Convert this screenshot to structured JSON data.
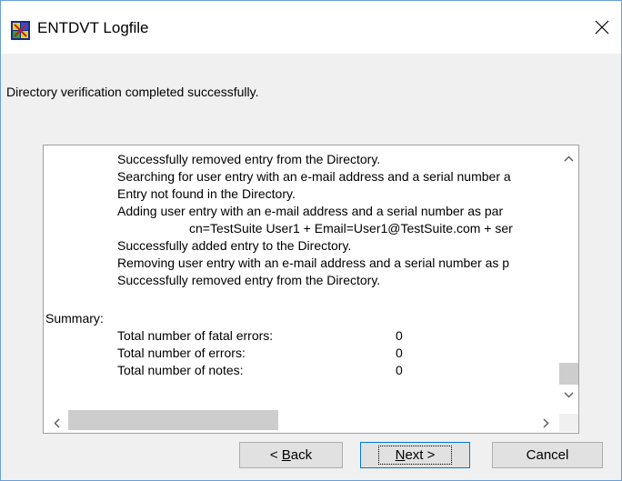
{
  "window": {
    "title": "ENTDVT Logfile"
  },
  "status_message": "Directory verification completed successfully.",
  "log": {
    "lines": [
      "Successfully removed entry from the Directory.",
      "Searching for user entry with an e-mail address and a serial number a",
      "Entry not found in the Directory.",
      "Adding user entry with an e-mail address and a serial number as par",
      "cn=TestSuite User1 + Email=User1@TestSuite.com + ser",
      "Successfully added entry to the Directory.",
      "Removing user entry with an e-mail address and a serial number as p",
      "Successfully removed entry from the Directory."
    ],
    "summary_label": "Summary:",
    "summary": [
      {
        "label": "Total number of fatal errors:",
        "value": "0"
      },
      {
        "label": "Total number of errors:",
        "value": "0"
      },
      {
        "label": "Total number of notes:",
        "value": "0"
      }
    ]
  },
  "buttons": {
    "back_prefix": "< ",
    "back_mnemonic": "B",
    "back_rest": "ack",
    "next_mnemonic": "N",
    "next_rest": "ext >",
    "cancel": "Cancel"
  },
  "icons": {
    "app": "entdvt-app-icon",
    "close": "close-icon",
    "scroll_up": "chevron-up-icon",
    "scroll_down": "chevron-down-icon",
    "scroll_left": "chevron-left-icon",
    "scroll_right": "chevron-right-icon"
  }
}
